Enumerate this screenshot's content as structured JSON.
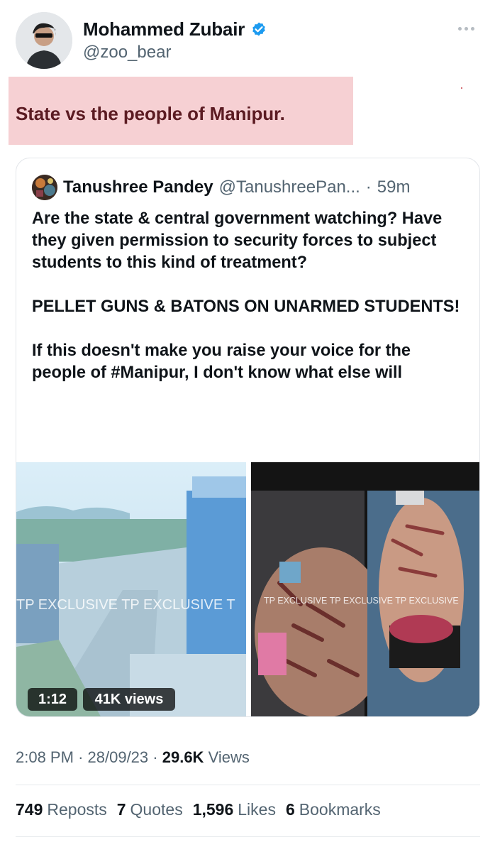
{
  "author": {
    "name": "Mohammed Zubair",
    "handle": "@zoo_bear",
    "verified": true
  },
  "tweet": {
    "text": "State vs the people of Manipur."
  },
  "quoted_tweet": {
    "name": "Tanushree Pandey",
    "handle": "@TanushreePan...",
    "separator": "·",
    "time": "59m",
    "body": "Are the state & central government watching? Have they given permission to security forces to subject students to this kind of treatment?\n\nPELLET GUNS & BATONS ON UNARMED STUDENTS!\n\nIf this doesn't make you raise your voice for the people of #Manipur, I don't know what else will",
    "media": {
      "left_watermark": "TP EXCLUSIVE TP EXCLUSIVE T",
      "right_watermark": "TP EXCLUSIVE TP EXCLUSIVE TP EXCLUSIVE",
      "duration": "1:12",
      "views": "41K views"
    }
  },
  "meta": {
    "time": "2:08 PM",
    "sep1": "·",
    "date": "28/09/23",
    "sep2": "·",
    "views_count": "29.6K",
    "views_label": "Views"
  },
  "stats": [
    {
      "count": "749",
      "label": "Reposts"
    },
    {
      "count": "7",
      "label": "Quotes"
    },
    {
      "count": "1,596",
      "label": "Likes"
    },
    {
      "count": "6",
      "label": "Bookmarks"
    }
  ],
  "colors": {
    "verified": "#1d9bf0",
    "highlight": "#f6d0d3",
    "secondary_text": "#536471"
  },
  "icons": [
    "verified-badge-icon",
    "more-options-icon"
  ]
}
